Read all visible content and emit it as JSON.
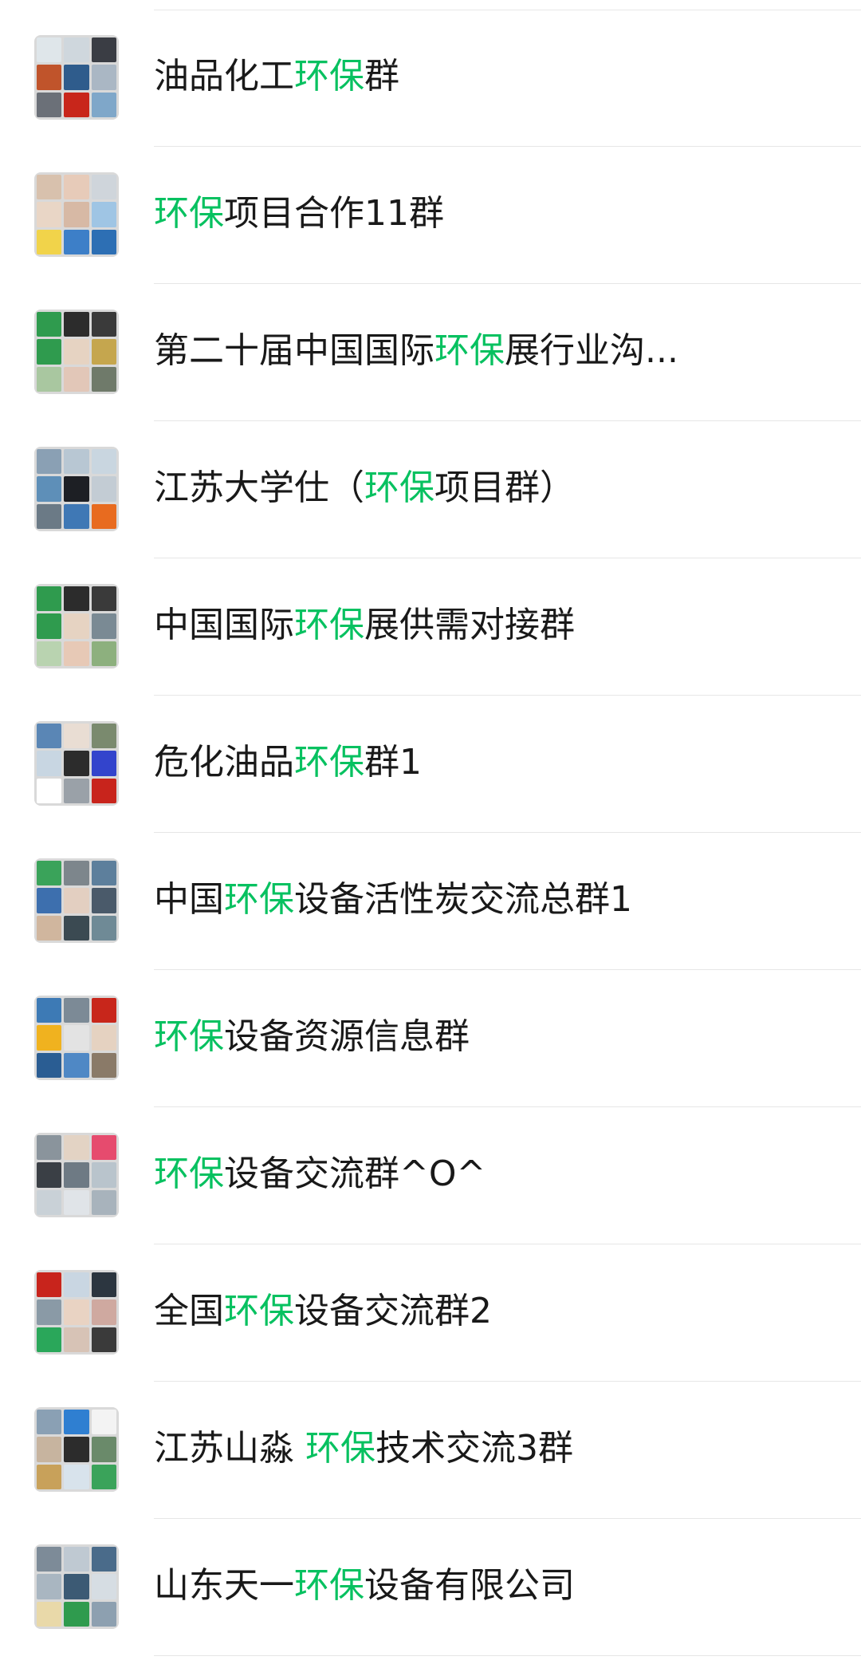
{
  "groups": [
    {
      "parts": [
        {
          "t": "油品化工",
          "hl": false
        },
        {
          "t": "环保",
          "hl": true
        },
        {
          "t": "群",
          "hl": false
        }
      ],
      "avatar_tiles": [
        "#dfe6ea",
        "#cfd7dd",
        "#3a3d44",
        "#c0542b",
        "#2f5c8c",
        "#aab7c4",
        "#6b7078",
        "#c8261b",
        "#7fa7c9"
      ]
    },
    {
      "parts": [
        {
          "t": "环保",
          "hl": true
        },
        {
          "t": "项目合作11群",
          "hl": false
        }
      ],
      "avatar_tiles": [
        "#d8c1ad",
        "#e7cbb9",
        "#cfd5db",
        "#e9d6c6",
        "#d7b9a5",
        "#9fc5e4",
        "#f1d34a",
        "#3d7fc8",
        "#2d6fb4"
      ]
    },
    {
      "parts": [
        {
          "t": "第二十届中国国际",
          "hl": false
        },
        {
          "t": "环保",
          "hl": true
        },
        {
          "t": "展行业沟...",
          "hl": false
        }
      ],
      "avatar_tiles": [
        "#2f9b4e",
        "#2c2c2c",
        "#3a3a3a",
        "#2f9b4e",
        "#e6d3c2",
        "#c5a64e",
        "#a9c7a0",
        "#e2c7b8",
        "#6f7a6a"
      ]
    },
    {
      "parts": [
        {
          "t": "江苏大学仕（",
          "hl": false
        },
        {
          "t": "环保",
          "hl": true
        },
        {
          "t": "项目群）",
          "hl": false
        }
      ],
      "avatar_tiles": [
        "#8aa0b4",
        "#b8c7d3",
        "#c9d6e0",
        "#5e8fb8",
        "#1d1f24",
        "#c3ccd4",
        "#6b7a86",
        "#3f78b5",
        "#e86b1f"
      ]
    },
    {
      "parts": [
        {
          "t": "中国国际",
          "hl": false
        },
        {
          "t": "环保",
          "hl": true
        },
        {
          "t": "展供需对接群",
          "hl": false
        }
      ],
      "avatar_tiles": [
        "#2f9b4e",
        "#2c2c2c",
        "#3a3a3a",
        "#2f9b4e",
        "#e6d3c2",
        "#7a8a94",
        "#b9d3b0",
        "#e7c9b6",
        "#8db07e"
      ]
    },
    {
      "parts": [
        {
          "t": "危化油品",
          "hl": false
        },
        {
          "t": "环保",
          "hl": true
        },
        {
          "t": "群1",
          "hl": false
        }
      ],
      "avatar_tiles": [
        "#5a86b5",
        "#e9ddd3",
        "#7a8a6e",
        "#c8d6e2",
        "#2c2c2c",
        "#3344cc",
        "#ffffff",
        "#9aa1a8",
        "#c8241c"
      ]
    },
    {
      "parts": [
        {
          "t": "中国",
          "hl": false
        },
        {
          "t": "环保",
          "hl": true
        },
        {
          "t": "设备活性炭交流总群1",
          "hl": false
        }
      ],
      "avatar_tiles": [
        "#3aa35a",
        "#7d868c",
        "#5d7f9c",
        "#3d6fae",
        "#e3cfc1",
        "#4a5a6a",
        "#d0b69e",
        "#3b4a52",
        "#6f8a96"
      ]
    },
    {
      "parts": [
        {
          "t": "环保",
          "hl": true
        },
        {
          "t": "设备资源信息群",
          "hl": false
        }
      ],
      "avatar_tiles": [
        "#3d7ab5",
        "#7c8a96",
        "#c8261b",
        "#f0b21f",
        "#e3e3e3",
        "#e5d2c1",
        "#2a5d93",
        "#4f88c5",
        "#8a7a68"
      ]
    },
    {
      "parts": [
        {
          "t": "环保",
          "hl": true
        },
        {
          "t": "设备交流群^O^",
          "hl": false
        }
      ],
      "avatar_tiles": [
        "#8a949c",
        "#e3d3c4",
        "#e64b6e",
        "#3a3f45",
        "#6e7a84",
        "#b9c4cc",
        "#c9d1d7",
        "#e0e4e8",
        "#a8b3bc"
      ]
    },
    {
      "parts": [
        {
          "t": "全国",
          "hl": false
        },
        {
          "t": "环保",
          "hl": true
        },
        {
          "t": "设备交流群2",
          "hl": false
        }
      ],
      "avatar_tiles": [
        "#c8241c",
        "#c9d6e2",
        "#2c3640",
        "#8a9aa6",
        "#e9d3c3",
        "#cfa9a0",
        "#2aa75a",
        "#d7c3b6",
        "#3a3a3a"
      ]
    },
    {
      "parts": [
        {
          "t": "江苏山淼 ",
          "hl": false
        },
        {
          "t": "环保",
          "hl": true
        },
        {
          "t": "技术交流3群",
          "hl": false
        }
      ],
      "avatar_tiles": [
        "#8aa0b4",
        "#2f7fd1",
        "#f3f3f3",
        "#c7b49f",
        "#2c2c2c",
        "#6a8a6a",
        "#c8a15a",
        "#d8e3ec",
        "#3aa35a"
      ]
    },
    {
      "parts": [
        {
          "t": "山东天一",
          "hl": false
        },
        {
          "t": "环保",
          "hl": true
        },
        {
          "t": "设备有限公司",
          "hl": false
        }
      ],
      "avatar_tiles": [
        "#7d8b98",
        "#bfc9d2",
        "#4a6b8a",
        "#a9b6c1",
        "#3c5a74",
        "#d6dde3",
        "#e9d9a9",
        "#2f9b4e",
        "#8da0b0"
      ]
    }
  ],
  "colors": {
    "highlight": "#07c160",
    "text": "#191919",
    "divider": "#e6e6e6",
    "avatar_bg": "#d9d9d9"
  }
}
